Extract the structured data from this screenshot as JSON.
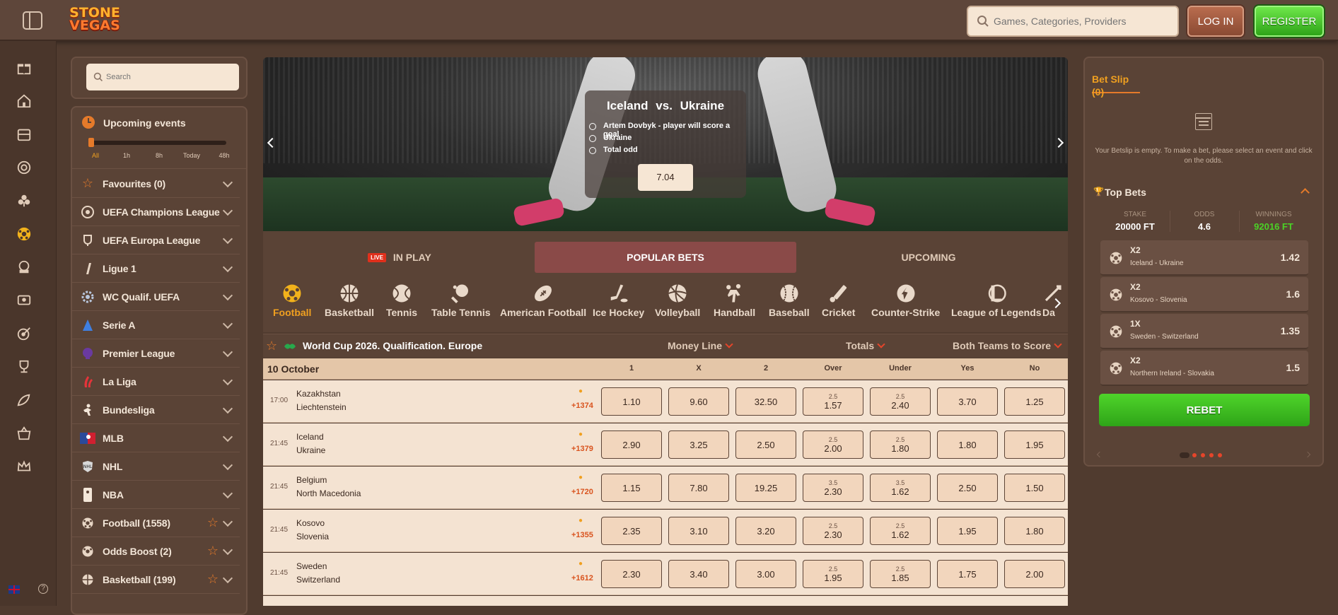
{
  "header": {
    "logo_top": "STONE",
    "logo_bottom": "VEGAS",
    "search_placeholder": "Games, Categories, Providers",
    "login_label": "LOG IN",
    "register_label": "REGISTER"
  },
  "sidebar": {
    "search_placeholder": "Search",
    "upcoming_title": "Upcoming events",
    "time_filters": [
      "All",
      "1h",
      "8h",
      "Today",
      "48h"
    ],
    "items": [
      {
        "label": "Favourites (0)",
        "icon": "star-icon"
      },
      {
        "label": "UEFA Champions League",
        "icon": "champions-league-icon"
      },
      {
        "label": "UEFA Europa League",
        "icon": "europa-league-icon"
      },
      {
        "label": "Ligue 1",
        "icon": "ligue1-icon"
      },
      {
        "label": "WC Qualif. UEFA",
        "icon": "uefa-icon"
      },
      {
        "label": "Serie A",
        "icon": "serie-a-icon"
      },
      {
        "label": "Premier League",
        "icon": "premier-league-icon"
      },
      {
        "label": "La Liga",
        "icon": "la-liga-icon"
      },
      {
        "label": "Bundesliga",
        "icon": "bundesliga-icon"
      },
      {
        "label": "MLB",
        "icon": "mlb-icon"
      },
      {
        "label": "NHL",
        "icon": "nhl-icon"
      },
      {
        "label": "NBA",
        "icon": "nba-icon"
      },
      {
        "label": "Football (1558)",
        "icon": "football-icon"
      },
      {
        "label": "Odds Boost (2)",
        "icon": "odds-boost-icon"
      },
      {
        "label": "Basketball (199)",
        "icon": "basketball-icon"
      }
    ]
  },
  "hero": {
    "title_home": "Iceland",
    "title_vs": "vs.",
    "title_away": "Ukraine",
    "options": [
      "Artem Dovbyk - player will score a goal",
      "Ukraine",
      "Total odd"
    ],
    "odd": "7.04"
  },
  "tabs": {
    "live_badge": "LIVE",
    "inplay": "IN PLAY",
    "popular": "POPULAR BETS",
    "upcoming": "UPCOMING"
  },
  "sports": [
    "Football",
    "Basketball",
    "Tennis",
    "Table Tennis",
    "American Football",
    "Ice Hockey",
    "Volleyball",
    "Handball",
    "Baseball",
    "Cricket",
    "Counter-Strike",
    "League of Legends",
    "Da"
  ],
  "league": {
    "title": "World Cup 2026. Qualification. Europe",
    "market1": "Money Line",
    "market2": "Totals",
    "market3": "Both Teams to Score",
    "date": "10 October",
    "cols": [
      "1",
      "X",
      "2",
      "Over",
      "Under",
      "Yes",
      "No"
    ]
  },
  "matches": [
    {
      "time": "17:00",
      "home": "Kazakhstan",
      "away": "Liechtenstein",
      "count": "+1374",
      "o1": "1.10",
      "ox": "9.60",
      "o2": "32.50",
      "line_over": "2.5",
      "over": "1.57",
      "line_under": "2.5",
      "under": "2.40",
      "yes": "3.70",
      "no": "1.25"
    },
    {
      "time": "21:45",
      "home": "Iceland",
      "away": "Ukraine",
      "count": "+1379",
      "o1": "2.90",
      "ox": "3.25",
      "o2": "2.50",
      "line_over": "2.5",
      "over": "2.00",
      "line_under": "2.5",
      "under": "1.80",
      "yes": "1.80",
      "no": "1.95"
    },
    {
      "time": "21:45",
      "home": "Belgium",
      "away": "North Macedonia",
      "count": "+1720",
      "o1": "1.15",
      "ox": "7.80",
      "o2": "19.25",
      "line_over": "3.5",
      "over": "2.30",
      "line_under": "3.5",
      "under": "1.62",
      "yes": "2.50",
      "no": "1.50"
    },
    {
      "time": "21:45",
      "home": "Kosovo",
      "away": "Slovenia",
      "count": "+1355",
      "o1": "2.35",
      "ox": "3.10",
      "o2": "3.20",
      "line_over": "2.5",
      "over": "2.30",
      "line_under": "2.5",
      "under": "1.62",
      "yes": "1.95",
      "no": "1.80"
    },
    {
      "time": "21:45",
      "home": "Sweden",
      "away": "Switzerland",
      "count": "+1612",
      "o1": "2.30",
      "ox": "3.40",
      "o2": "3.00",
      "line_over": "2.5",
      "over": "1.95",
      "line_under": "2.5",
      "under": "1.85",
      "yes": "1.75",
      "no": "2.00"
    }
  ],
  "betslip": {
    "title": "Bet Slip (0)",
    "empty_text": "Your Betslip is empty. To make a bet, please select an event and click on the odds.",
    "top_bets_title": "Top Bets",
    "stake_label": "STAKE",
    "stake_value": "20000 FT",
    "odds_label": "ODDS",
    "odds_value": "4.6",
    "winnings_label": "WINNINGS",
    "winnings_value": "92016 FT",
    "bets": [
      {
        "type": "X2",
        "match": "Iceland - Ukraine",
        "odd": "1.42"
      },
      {
        "type": "X2",
        "match": "Kosovo - Slovenia",
        "odd": "1.6"
      },
      {
        "type": "1X",
        "match": "Sweden - Switzerland",
        "odd": "1.35"
      },
      {
        "type": "X2",
        "match": "Northern Ireland - Slovakia",
        "odd": "1.5"
      }
    ],
    "rebet_label": "REBET"
  },
  "colors": {
    "accent": "#e57a2a",
    "register_green": "#3cc21c",
    "background": "#503b2f"
  }
}
